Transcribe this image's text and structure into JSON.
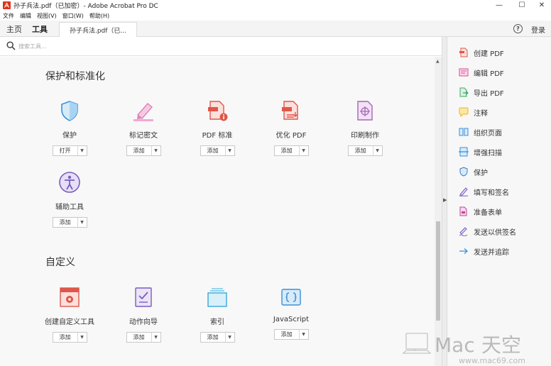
{
  "window": {
    "title": "孙子兵法.pdf（已加密）- Adobe Acrobat Pro DC",
    "minimize": "—",
    "maximize": "☐",
    "close": "✕"
  },
  "menu": [
    "文件",
    "编辑",
    "视图(V)",
    "窗口(W)",
    "帮助(H)"
  ],
  "tabs": {
    "home": "主页",
    "tools": "工具",
    "document": "孙子兵法.pdf（已...",
    "help": "?",
    "login": "登录"
  },
  "search": {
    "placeholder": "搜索工具..."
  },
  "sections": [
    {
      "title": "保护和标准化",
      "tools": [
        {
          "label": "保护",
          "button": "打开"
        },
        {
          "label": "标记密文",
          "button": "添加"
        },
        {
          "label": "PDF 标准",
          "button": "添加"
        },
        {
          "label": "优化 PDF",
          "button": "添加"
        },
        {
          "label": "印刷制作",
          "button": "添加"
        },
        {
          "label": "辅助工具",
          "button": "添加"
        }
      ]
    },
    {
      "title": "自定义",
      "tools": [
        {
          "label": "创建自定义工具",
          "button": "添加"
        },
        {
          "label": "动作向导",
          "button": "添加"
        },
        {
          "label": "索引",
          "button": "添加"
        },
        {
          "label": "JavaScript",
          "button": "添加"
        }
      ]
    }
  ],
  "sidebar": {
    "items": [
      {
        "label": "创建 PDF",
        "icon": "create-pdf-icon",
        "color": "#e0564a"
      },
      {
        "label": "编辑 PDF",
        "icon": "edit-pdf-icon",
        "color": "#d9488f"
      },
      {
        "label": "导出 PDF",
        "icon": "export-pdf-icon",
        "color": "#3ea76a"
      },
      {
        "label": "注释",
        "icon": "comment-icon",
        "color": "#f0b418"
      },
      {
        "label": "组织页面",
        "icon": "organize-pages-icon",
        "color": "#3a8fd8"
      },
      {
        "label": "增强扫描",
        "icon": "enhance-scan-icon",
        "color": "#3a8fd8"
      },
      {
        "label": "保护",
        "icon": "protect-icon",
        "color": "#3a78c8"
      },
      {
        "label": "填写和签名",
        "icon": "fill-sign-icon",
        "color": "#7a5cc0"
      },
      {
        "label": "准备表单",
        "icon": "prepare-form-icon",
        "color": "#c2449a"
      },
      {
        "label": "发送以供签名",
        "icon": "send-for-signature-icon",
        "color": "#7a5cc0"
      },
      {
        "label": "发送并追踪",
        "icon": "send-track-icon",
        "color": "#3a8fd8"
      }
    ]
  }
}
